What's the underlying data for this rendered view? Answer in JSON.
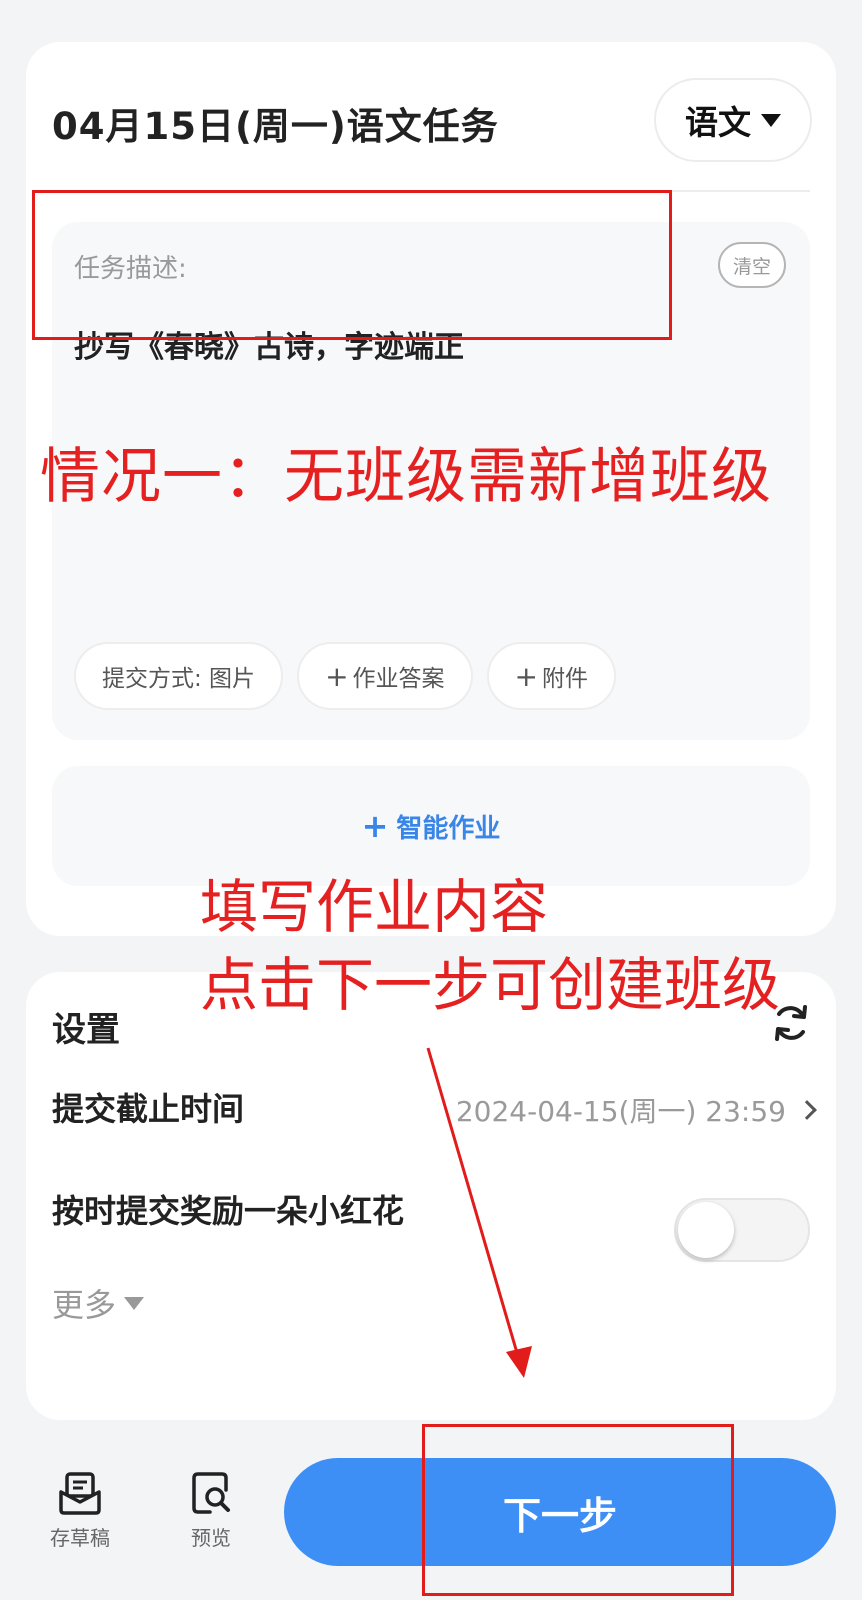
{
  "task_card": {
    "title": "04月15日(周一)语文任务",
    "subject": "语文",
    "description_label": "任务描述:",
    "description_text": "抄写《春晓》古诗，字迹端正",
    "clear_label": "清空",
    "chips": {
      "submit_method": "提交方式: 图片",
      "homework_answer": "作业答案",
      "attachment": "附件"
    },
    "smart_homework": "智能作业"
  },
  "annotations": {
    "case_title": "情况一：无班级需新增班级",
    "instruction_line1": "填写作业内容",
    "instruction_line2": "点击下一步可创建班级",
    "color": "#e52020"
  },
  "settings": {
    "title": "设置",
    "deadline_label": "提交截止时间",
    "deadline_value": "2024-04-15(周一) 23:59",
    "reward_label": "按时提交奖励一朵小红花",
    "reward_enabled": false,
    "more_label": "更多"
  },
  "bottom_bar": {
    "save_draft": "存草稿",
    "preview": "预览",
    "next": "下一步"
  },
  "colors": {
    "accent": "#3d8ff5",
    "smart_link": "#3a86e8",
    "annotation": "#e21b1b"
  },
  "icons": [
    "caret-down-icon",
    "plus-icon",
    "refresh-icon",
    "chevron-right-icon",
    "draft-box-icon",
    "preview-search-icon"
  ]
}
